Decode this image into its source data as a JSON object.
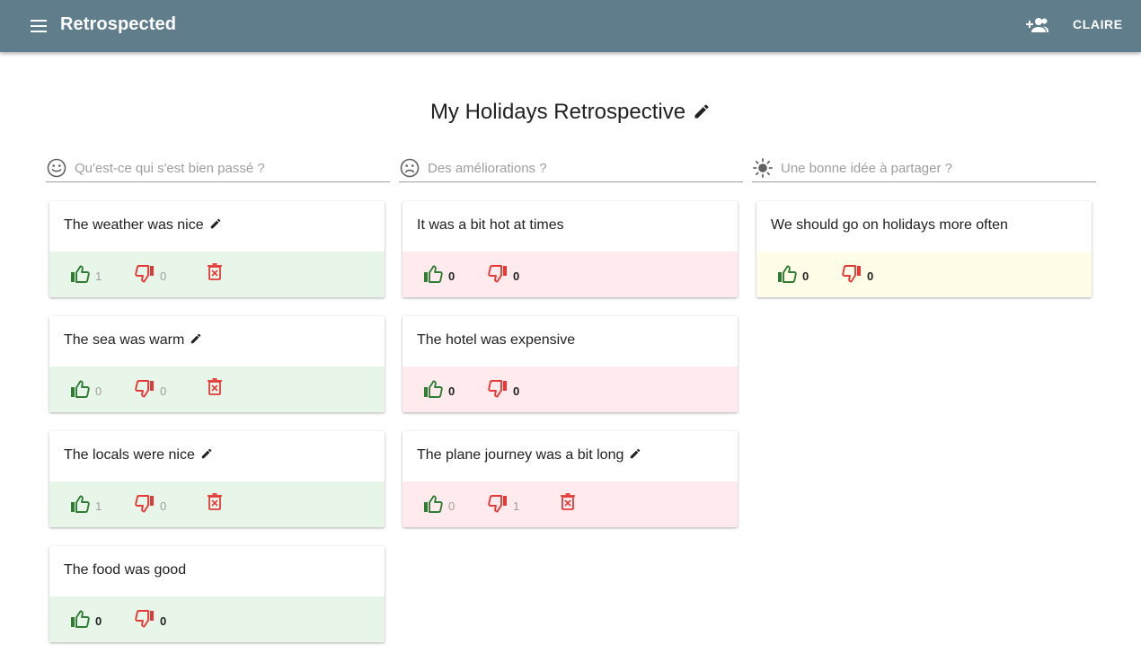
{
  "app": {
    "title": "Retrospected",
    "user": "CLAIRE"
  },
  "board": {
    "title": "My Holidays Retrospective"
  },
  "colors": {
    "appbar": "#607d8b",
    "like": "#2e7d32",
    "dislike": "#e53935"
  },
  "columns": [
    {
      "icon": "smiley-icon",
      "placeholder": "Qu'est-ce qui s'est bien passé ?",
      "cards": [
        {
          "text": "The weather was nice",
          "editable": true,
          "likes": "1",
          "dislikes": "0",
          "deletable": true
        },
        {
          "text": "The sea was warm",
          "editable": true,
          "likes": "0",
          "dislikes": "0",
          "deletable": true
        },
        {
          "text": "The locals were nice",
          "editable": true,
          "likes": "1",
          "dislikes": "0",
          "deletable": true
        },
        {
          "text": "The food was good",
          "editable": false,
          "likes": "0",
          "dislikes": "0",
          "deletable": false
        }
      ]
    },
    {
      "icon": "sad-face-icon",
      "placeholder": "Des améliorations ?",
      "cards": [
        {
          "text": "It was a bit hot at times",
          "editable": false,
          "likes": "0",
          "dislikes": "0",
          "deletable": false
        },
        {
          "text": "The hotel was expensive",
          "editable": false,
          "likes": "0",
          "dislikes": "0",
          "deletable": false
        },
        {
          "text": "The plane journey was a bit long",
          "editable": true,
          "likes": "0",
          "dislikes": "1",
          "deletable": true
        }
      ]
    },
    {
      "icon": "sun-icon",
      "placeholder": "Une bonne idée à partager ?",
      "cards": [
        {
          "text": "We should go on holidays more often",
          "editable": false,
          "likes": "0",
          "dislikes": "0",
          "deletable": false
        }
      ]
    }
  ]
}
